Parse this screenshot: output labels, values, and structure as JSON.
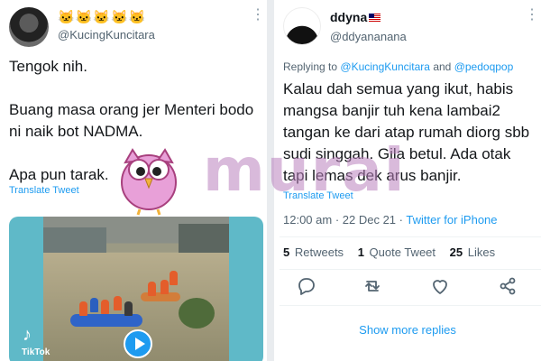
{
  "left_tweet": {
    "display_name": "🐱🐱🐱🐱🐱",
    "handle": "@KucingKuncitara",
    "body": "Tengok nih.\n\nBuang masa orang jer Menteri bodo ni naik bot NADMA.\n\nApa pun tarak.",
    "translate_label": "Translate Tweet",
    "video": {
      "source_label": "TikTok"
    }
  },
  "right_tweet": {
    "display_name": "ddyna",
    "handle": "@ddyananana",
    "replying_prefix": "Replying to",
    "replying_to_1": "@KucingKuncitara",
    "replying_and": "and",
    "replying_to_2": "@pedoqpop",
    "body": "Kalau dah semua yang ikut, habis mangsa banjir tuh kena lambai2 tangan ke dari atap rumah diorg sbb sudi singgah. Gila betul. Ada otak tapi lemas dek arus banjir.",
    "translate_label": "Translate Tweet",
    "time": "12:00 am",
    "date": "22 Dec 21",
    "client": "Twitter for iPhone",
    "retweets_count": "5",
    "retweets_label": "Retweets",
    "quote_count": "1",
    "quote_label": "Quote Tweet",
    "likes_count": "25",
    "likes_label": "Likes",
    "show_more": "Show more replies"
  },
  "watermark": {
    "text": "murai"
  },
  "colors": {
    "link": "#1d9bf0",
    "muted": "#536471",
    "watermark": "#ba82be"
  }
}
